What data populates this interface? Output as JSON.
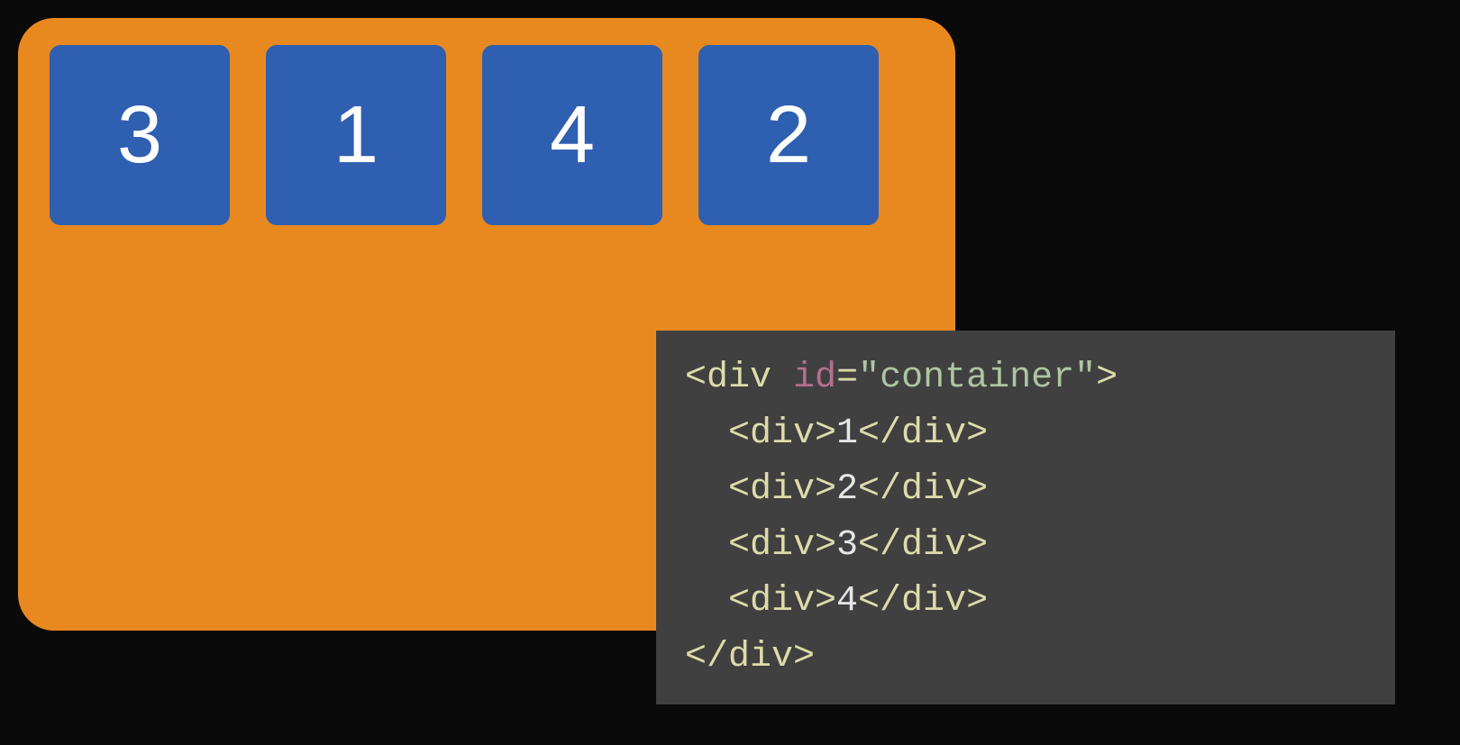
{
  "container": {
    "items_display_order": [
      "3",
      "1",
      "4",
      "2"
    ]
  },
  "code": {
    "outer_open_tag": "div",
    "outer_open_attr_name": "id",
    "outer_open_attr_value": "\"container\"",
    "lines": [
      {
        "open": "<div>",
        "text": "1",
        "close": "</div>"
      },
      {
        "open": "<div>",
        "text": "2",
        "close": "</div>"
      },
      {
        "open": "<div>",
        "text": "3",
        "close": "</div>"
      },
      {
        "open": "<div>",
        "text": "4",
        "close": "</div>"
      }
    ],
    "outer_close": "</div>"
  }
}
